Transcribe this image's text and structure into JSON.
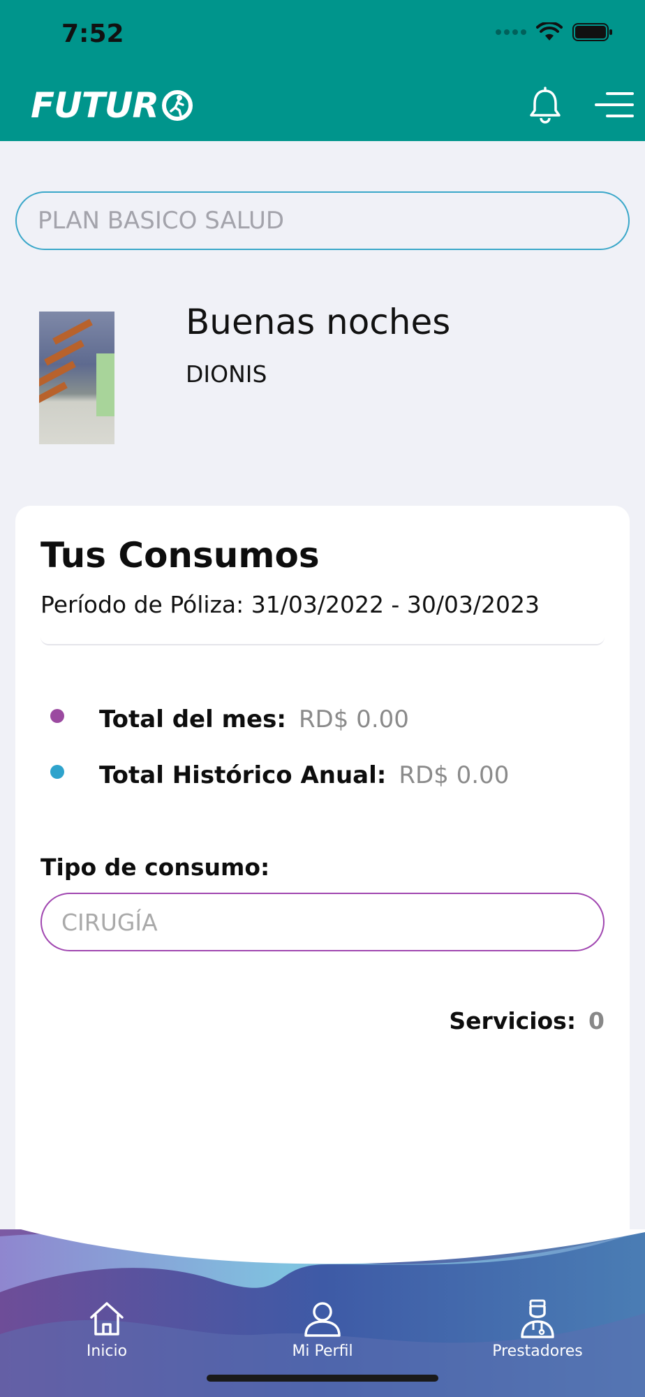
{
  "status_bar": {
    "time": "7:52"
  },
  "header": {
    "logo_text": "FUTUR",
    "icons": [
      "bell-icon",
      "hamburger-menu-icon"
    ]
  },
  "plan": {
    "selected": "PLAN BASICO SALUD"
  },
  "greeting": {
    "salutation": "Buenas noches",
    "name": "DIONIS"
  },
  "consumos": {
    "title": "Tus Consumos",
    "period_label": "Período de Póliza:",
    "period_value": "31/03/2022 - 30/03/2023",
    "totals": [
      {
        "label": "Total del mes:",
        "value": "RD$ 0.00",
        "color": "#9b4aa0"
      },
      {
        "label": "Total Histórico Anual:",
        "value": "RD$ 0.00",
        "color": "#2ea3cc"
      }
    ],
    "tipo_label": "Tipo de consumo:",
    "tipo_selected": "CIRUGÍA",
    "servicios_label": "Servicios:",
    "servicios_value": "0"
  },
  "bottom_nav": {
    "items": [
      {
        "label": "Inicio",
        "icon": "home-icon"
      },
      {
        "label": "Mi Perfil",
        "icon": "user-icon"
      },
      {
        "label": "Prestadores",
        "icon": "doctor-icon"
      }
    ]
  },
  "colors": {
    "header_bg": "#00958c",
    "page_bg": "#f0f1f7",
    "plan_border": "#3aa7c9",
    "tipo_border": "#a046b0"
  }
}
